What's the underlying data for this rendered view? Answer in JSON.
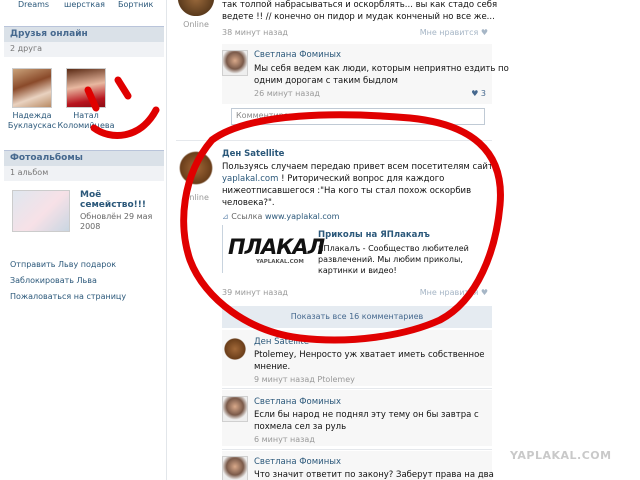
{
  "top_links": [
    "Dreams",
    "шерсткая",
    "Бортник"
  ],
  "friends_online": {
    "title": "Друзья онлайн",
    "count": "2 друга",
    "people": [
      {
        "first": "Надежда",
        "last": "Буклаускас"
      },
      {
        "first": "Натал",
        "last": "Коломийцева"
      }
    ]
  },
  "albums": {
    "title": "Фотоальбомы",
    "count": "1 альбом",
    "album": {
      "title": "Моё семейство!!!",
      "updated": "Обновлён 29 мая 2008"
    }
  },
  "side_links": [
    "Отправить Льву подарок",
    "Заблокировать Льва",
    "Пожаловаться на страницу"
  ],
  "post1": {
    "online": "Online",
    "line1": "так толпой набрасываться и оскорблять... вы как стадо себя",
    "line2": "ведете !! // конечно он пидор и мудак конченый но все же...",
    "time": "38 минут назад",
    "like": "Мне нравится"
  },
  "comment1": {
    "author": "Светлана Фоминых",
    "text1": "Мы себя ведем как люди, которым неприятно ездить по",
    "text2": "одним дорогам с таким быдлом",
    "time": "26 минут назад",
    "likes": "3"
  },
  "comment_input": {
    "placeholder": "Комментировать..."
  },
  "post2": {
    "author": "Ден Satellite",
    "online": "Online",
    "line1": "Пользуясь случаем передаю привет всем посетителям сайта",
    "line2_link": "yaplakal.com",
    "line2_rest": " ! Риторический вопрос для каждого",
    "line3": "нижеотписавшегося :\"На кого ты стал похож оскорбив",
    "line4": "человека?\".",
    "link_label": "Ссылка",
    "link_url": "www.yaplakal.com",
    "preview_logo": "ПЛАКАЛ",
    "preview_logo_sub": "YAPLAKAL.COM",
    "preview_title": "Приколы на ЯПлакалъ",
    "preview_desc1": "ЯПлакалъ - Сообщество любителей",
    "preview_desc2": "развлечений. Мы любим приколы,",
    "preview_desc3": "картинки и видео!",
    "time": "39 минут назад",
    "like": "Мне нравится"
  },
  "show_all": "Показать все 16 комментариев",
  "comment2": {
    "author": "Ден Satellite",
    "text1": "Ptolemey, Ненросто уж хватает иметь собственное",
    "text2": "мнение.",
    "meta": "9 минут назад Ptolemey"
  },
  "comment3": {
    "author": "Светлана Фоминых",
    "text1": "Если бы народ не поднял эту тему он бы завтра с",
    "text2": "похмела сел за руль",
    "time": "6 минут назад"
  },
  "comment4": {
    "author": "Светлана Фоминых",
    "text1": "Что значит ответит по закону? Заберут права на два"
  },
  "watermark": "YAPLAKAL.COM",
  "colors": {
    "accent": "#2b587a",
    "header_bg": "#dae1e8",
    "doodle": "#e00000"
  }
}
